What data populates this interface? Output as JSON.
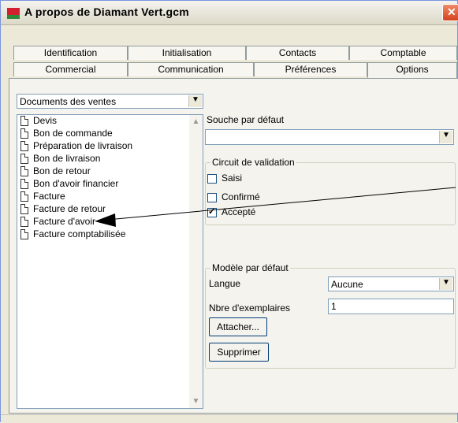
{
  "window": {
    "title": "A propos de Diamant Vert.gcm"
  },
  "tabs_row1": [
    "Identification",
    "Initialisation",
    "Contacts",
    "Comptable"
  ],
  "tabs_row2": [
    "Commercial",
    "Communication",
    "Préférences",
    "Options"
  ],
  "selected_tab": "Options",
  "document_type_select": {
    "value": "Documents des ventes"
  },
  "document_list": [
    "Devis",
    "Bon de commande",
    "Préparation de livraison",
    "Bon de livraison",
    "Bon de retour",
    "Bon d'avoir financier",
    "Facture",
    "Facture de retour",
    "Facture d'avoir",
    "Facture comptabilisée"
  ],
  "souche": {
    "label": "Souche par défaut",
    "value": ""
  },
  "circuit": {
    "title": "Circuit de validation",
    "items": [
      {
        "label": "Saisi",
        "checked": false
      },
      {
        "label": "Confirmé",
        "checked": false
      },
      {
        "label": "Accepté",
        "checked": true
      }
    ]
  },
  "modele": {
    "title": "Modèle par défaut",
    "langue_label": "Langue",
    "langue_value": "Aucune",
    "exemplaires_label": "Nbre d'exemplaires",
    "exemplaires_value": "1",
    "attach_button": "Attacher...",
    "delete_button": "Supprimer"
  },
  "colors": {
    "title_bg": "#f4f3ee",
    "close_button": "#d3421c",
    "panel_bg": "#f4f3ee"
  }
}
